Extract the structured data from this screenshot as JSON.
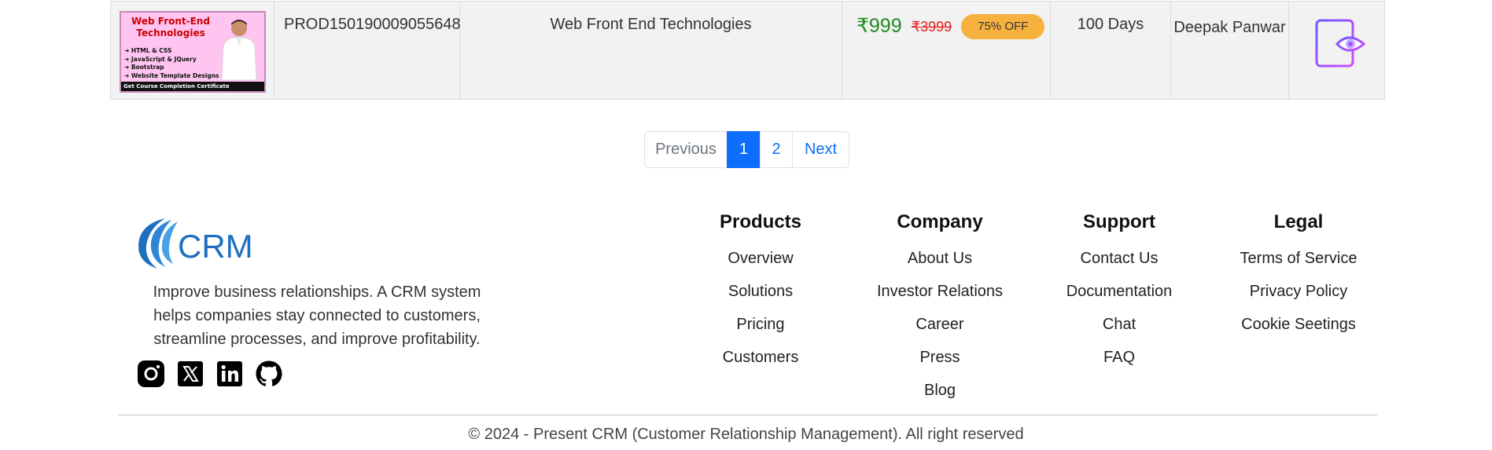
{
  "product": {
    "thumb_title": "Web Front-End Technologies",
    "thumb_items": [
      "➜ HTML & CSS",
      "➜ JavaScript & JQuery",
      "➜ Bootstrap",
      "➜ Website Template Designs"
    ],
    "thumb_footer": "Get Course Completion Certificate",
    "id": "PROD150190009055648",
    "name": "Web Front End Technologies",
    "price": "₹999",
    "old_price": "₹3999",
    "discount": "75% OFF",
    "duration": "100 Days",
    "instructor": "Deepak Panwar"
  },
  "pagination": {
    "previous": "Previous",
    "pages": [
      "1",
      "2"
    ],
    "active_page": "1",
    "next": "Next"
  },
  "footer": {
    "logo_text": "CRM",
    "about": "Improve business relationships. A CRM system helps companies stay connected to customers, streamline processes, and improve profitability.",
    "social": [
      "instagram-icon",
      "x-twitter-icon",
      "linkedin-icon",
      "github-icon"
    ],
    "columns": [
      {
        "title": "Products",
        "links": [
          "Overview",
          "Solutions",
          "Pricing",
          "Customers"
        ]
      },
      {
        "title": "Company",
        "links": [
          "About Us",
          "Investor Relations",
          "Career",
          "Press",
          "Blog"
        ]
      },
      {
        "title": "Support",
        "links": [
          "Contact Us",
          "Documentation",
          "Chat",
          "FAQ"
        ]
      },
      {
        "title": "Legal",
        "links": [
          "Terms of Service",
          "Privacy Policy",
          "Cookie Seetings"
        ]
      }
    ],
    "copyright": "© 2024 - Present CRM (Customer Relationship Management). All right reserved"
  },
  "colors": {
    "accent": "#0d6efd",
    "price_green": "#1f8a1f",
    "old_price_red": "#e02020",
    "badge_orange": "#f7b13f",
    "logo_blue": "#1f6fc0",
    "view_icon_purple": "#a64dff"
  }
}
